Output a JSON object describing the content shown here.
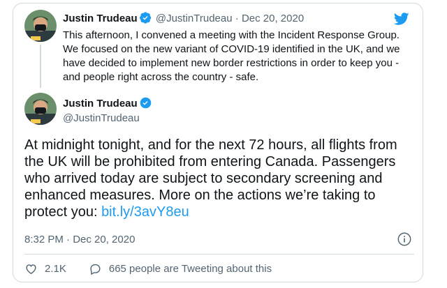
{
  "parent_tweet": {
    "name": "Justin Trudeau",
    "handle": "@JustinTrudeau",
    "separator": "·",
    "date": "Dec 20, 2020",
    "text": "This afternoon, I convened a meeting with the Incident Response Group. We focused on the new variant of COVID-19 identified in the UK, and we have decided to implement new border restrictions in order to keep you - and people right across the country - safe."
  },
  "main_tweet": {
    "name": "Justin Trudeau",
    "handle": "@JustinTrudeau",
    "text_before_link": "At midnight tonight, and for the next 72 hours, all flights from the UK will be prohibited from entering Canada. Passengers who arrived today are subject to secondary screening and enhanced measures. More on the actions we’re taking to protect you: ",
    "link": "bit.ly/3avY8eu",
    "timestamp": "8:32 PM · Dec 20, 2020"
  },
  "actions": {
    "likes": "2.1K",
    "tweeting": "665 people are Tweeting about this"
  },
  "icons": {
    "logo": "twitter-bird-icon",
    "verified": "verified-badge-icon",
    "info": "info-icon",
    "like": "heart-icon",
    "reply": "chat-bubble-icon"
  },
  "colors": {
    "brand": "#1d9bf0",
    "text": "#0f1419",
    "muted": "#536471",
    "border": "#cfd9de"
  }
}
